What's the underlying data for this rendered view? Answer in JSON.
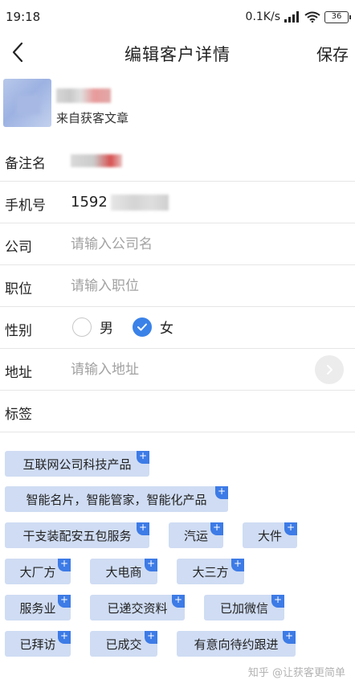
{
  "status_bar": {
    "time": "19:18",
    "net_speed": "0.1K/s",
    "battery": "36"
  },
  "header": {
    "title": "编辑客户详情",
    "save_label": "保存"
  },
  "customer": {
    "source": "来自获客文章"
  },
  "form": {
    "remark_label": "备注名",
    "phone_label": "手机号",
    "phone_prefix": "1592",
    "company_label": "公司",
    "company_placeholder": "请输入公司名",
    "position_label": "职位",
    "position_placeholder": "请输入职位",
    "gender_label": "性别",
    "gender_options": [
      "男",
      "女"
    ],
    "gender_selected": "女",
    "address_label": "地址",
    "address_placeholder": "请输入地址",
    "tags_label": "标签"
  },
  "tags": [
    "互联网公司科技产品",
    "智能名片，智能管家，智能化产品",
    "干支装配安五包服务",
    "汽运",
    "大件",
    "大厂方",
    "大电商",
    "大三方",
    "服务业",
    "已递交资料",
    "已加微信",
    "已拜访",
    "已成交",
    "有意向待约跟进"
  ],
  "tag_add_symbol": "+",
  "watermark": "知乎 @让获客更简单"
}
